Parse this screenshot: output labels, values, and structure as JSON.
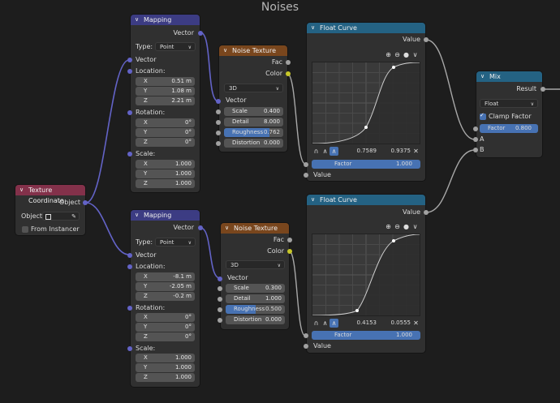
{
  "frame": {
    "title": "Noises"
  },
  "texcoord": {
    "title": "Texture Coordinate",
    "out_object": "Object",
    "object_label": "Object:",
    "from_instancer": "From Instancer"
  },
  "mapping1": {
    "title": "Mapping",
    "out_vector": "Vector",
    "type_label": "Type:",
    "type_value": "Point",
    "in_vector": "Vector",
    "location_label": "Location:",
    "location": [
      {
        "k": "X",
        "v": "0.51 m"
      },
      {
        "k": "Y",
        "v": "1.08 m"
      },
      {
        "k": "Z",
        "v": "2.21 m"
      }
    ],
    "rotation_label": "Rotation:",
    "rotation": [
      {
        "k": "X",
        "v": "0°"
      },
      {
        "k": "Y",
        "v": "0°"
      },
      {
        "k": "Z",
        "v": "0°"
      }
    ],
    "scale_label": "Scale:",
    "scale": [
      {
        "k": "X",
        "v": "1.000"
      },
      {
        "k": "Y",
        "v": "1.000"
      },
      {
        "k": "Z",
        "v": "1.000"
      }
    ]
  },
  "mapping2": {
    "title": "Mapping",
    "out_vector": "Vector",
    "type_label": "Type:",
    "type_value": "Point",
    "in_vector": "Vector",
    "location_label": "Location:",
    "location": [
      {
        "k": "X",
        "v": "-8.1 m"
      },
      {
        "k": "Y",
        "v": "-2.05 m"
      },
      {
        "k": "Z",
        "v": "-0.2 m"
      }
    ],
    "rotation_label": "Rotation:",
    "rotation": [
      {
        "k": "X",
        "v": "0°"
      },
      {
        "k": "Y",
        "v": "0°"
      },
      {
        "k": "Z",
        "v": "0°"
      }
    ],
    "scale_label": "Scale:",
    "scale": [
      {
        "k": "X",
        "v": "1.000"
      },
      {
        "k": "Y",
        "v": "1.000"
      },
      {
        "k": "Z",
        "v": "1.000"
      }
    ]
  },
  "noise1": {
    "title": "Noise Texture",
    "out_fac": "Fac",
    "out_color": "Color",
    "dimension": "3D",
    "in_vector": "Vector",
    "scale_label": "Scale",
    "scale": "0.400",
    "detail_label": "Detail",
    "detail": "8.000",
    "roughness_label": "Roughness",
    "roughness": "0.762",
    "roughness_fraction": 0.762,
    "distortion_label": "Distortion",
    "distortion": "0.000"
  },
  "noise2": {
    "title": "Noise Texture",
    "out_fac": "Fac",
    "out_color": "Color",
    "dimension": "3D",
    "in_vector": "Vector",
    "scale_label": "Scale",
    "scale": "0.300",
    "detail_label": "Detail",
    "detail": "1.000",
    "roughness_label": "Roughness",
    "roughness": "0.500",
    "roughness_fraction": 0.5,
    "distortion_label": "Distortion",
    "distortion": "0.000"
  },
  "curve1": {
    "title": "Float Curve",
    "out_value": "Value",
    "point_x": "0.7589",
    "point_y": "0.9375",
    "factor_label": "Factor",
    "factor": "1.000",
    "in_value": "Value"
  },
  "curve2": {
    "title": "Float Curve",
    "out_value": "Value",
    "point_x": "0.4153",
    "point_y": "0.0555",
    "factor_label": "Factor",
    "factor": "1.000",
    "in_value": "Value"
  },
  "mix": {
    "title": "Mix",
    "out_result": "Result",
    "data_type": "Float",
    "clamp_label": "Clamp Factor",
    "factor_label": "Factor",
    "factor": "0.800",
    "in_a": "A",
    "in_b": "B"
  },
  "colors": {
    "mapping_header": "#3c3c83",
    "texcoord_header": "#83314a",
    "noise_header": "#79461d",
    "curve_header": "#246283",
    "vector_socket": "#6363c7",
    "float_socket": "#a1a1a1",
    "color_socket": "#c7c729",
    "accent": "#4772b3"
  }
}
